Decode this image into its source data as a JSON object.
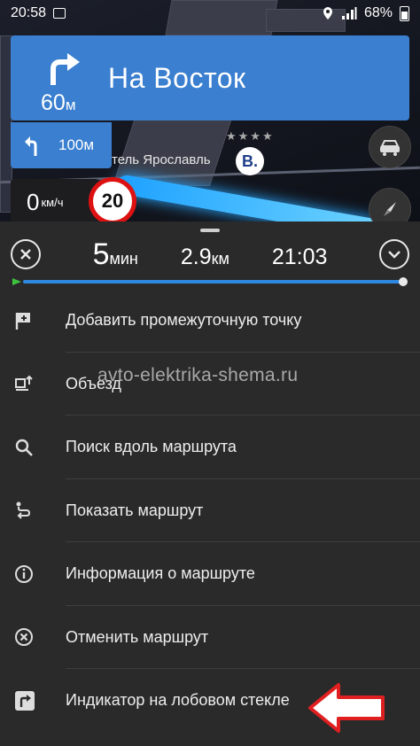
{
  "status_bar": {
    "time": "20:58",
    "battery": "68%"
  },
  "navigation": {
    "street": "На Восток",
    "distance_value": "60",
    "distance_unit": "м",
    "next_distance": "100м",
    "poi_label": "тель Ярославль",
    "poi_badge": "B.",
    "speed_value": "0",
    "speed_unit": "км/ч",
    "speed_limit": "20"
  },
  "trip": {
    "time_value": "5",
    "time_unit": "мин",
    "distance_value": "2.9",
    "distance_unit": "км",
    "arrival": "21:03"
  },
  "menu": {
    "items": [
      {
        "label": "Добавить промежуточную точку",
        "icon": "add-waypoint-icon"
      },
      {
        "label": "Объезд",
        "icon": "detour-icon"
      },
      {
        "label": "Поиск вдоль маршрута",
        "icon": "search-icon"
      },
      {
        "label": "Показать маршрут",
        "icon": "route-icon"
      },
      {
        "label": "Информация о маршруте",
        "icon": "info-icon"
      },
      {
        "label": "Отменить маршрут",
        "icon": "cancel-icon"
      },
      {
        "label": "Индикатор на лобовом стекле",
        "icon": "hud-icon"
      }
    ]
  },
  "watermark": "avto-elektrika-shema.ru",
  "colors": {
    "accent": "#3a7fd0",
    "panel": "#2a2a2a",
    "progress": "#2f88e0",
    "arrow": "#e02020"
  }
}
